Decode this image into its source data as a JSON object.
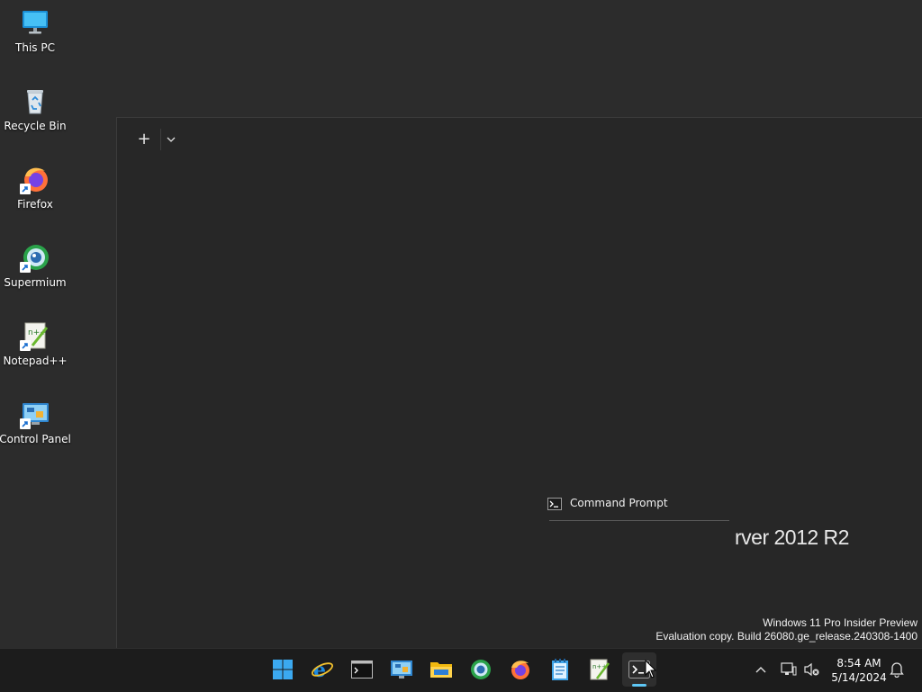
{
  "desktop": {
    "icons": [
      {
        "label": "This PC",
        "icon": "this-pc-icon"
      },
      {
        "label": "Recycle Bin",
        "icon": "recycle-bin-icon"
      },
      {
        "label": "Firefox",
        "icon": "firefox-icon"
      },
      {
        "label": "Supermium",
        "icon": "supermium-icon"
      },
      {
        "label": "Notepad++",
        "icon": "notepad-plus-plus-icon"
      },
      {
        "label": "Control Panel",
        "icon": "control-panel-icon"
      }
    ]
  },
  "terminal": {
    "new_tab_label": "+",
    "preview_label": "Command Prompt",
    "server_text": "rver 2012 R2"
  },
  "watermark": {
    "line1": "Windows 11 Pro Insider Preview",
    "line2": "Evaluation copy. Build 26080.ge_release.240308-1400"
  },
  "taskbar": {
    "apps": [
      {
        "name": "start-button",
        "icon": "windows-logo-icon"
      },
      {
        "name": "internet-explorer",
        "icon": "internet-explorer-icon"
      },
      {
        "name": "command-prompt",
        "icon": "cmd-icon"
      },
      {
        "name": "control-panel",
        "icon": "control-panel-icon"
      },
      {
        "name": "file-explorer",
        "icon": "folder-icon"
      },
      {
        "name": "supermium",
        "icon": "supermium-icon"
      },
      {
        "name": "firefox",
        "icon": "firefox-icon"
      },
      {
        "name": "notepad",
        "icon": "notepad-icon"
      },
      {
        "name": "notepad-plus-plus",
        "icon": "notepad-plus-plus-icon"
      },
      {
        "name": "terminal",
        "icon": "terminal-icon",
        "active": true
      }
    ],
    "clock": {
      "time": "8:54 AM",
      "date": "5/14/2024"
    }
  },
  "colors": {
    "accent": "#5ec7f5",
    "desktop_bg": "#2c2c2c",
    "taskbar_bg": "#1c1c1c"
  }
}
